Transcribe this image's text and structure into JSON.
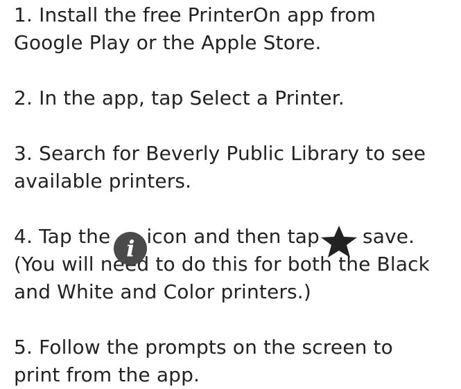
{
  "steps": {
    "s1": {
      "line1": "1. Install the free PrinterOn app from",
      "line2": "Google Play or the Apple Store."
    },
    "s2": {
      "line1": "2. In the app, tap Select a Printer."
    },
    "s3": {
      "line1": "3. Search for Beverly Public Library to see",
      "line2": "available printers."
    },
    "s4": {
      "part1": "4. Tap the",
      "part2": "icon and then tap",
      "part3": "save.",
      "line2": "(You will need to do this for both the Black",
      "line3": "and White and Color printers.)"
    },
    "s5": {
      "line1": "5. Follow the prompts on the screen to",
      "line2": "print from the app."
    }
  },
  "icons": {
    "info": {
      "name": "info-icon",
      "glyph": "i",
      "color": "#4a4a4a"
    },
    "star": {
      "name": "star-icon",
      "color": "#222222"
    }
  }
}
